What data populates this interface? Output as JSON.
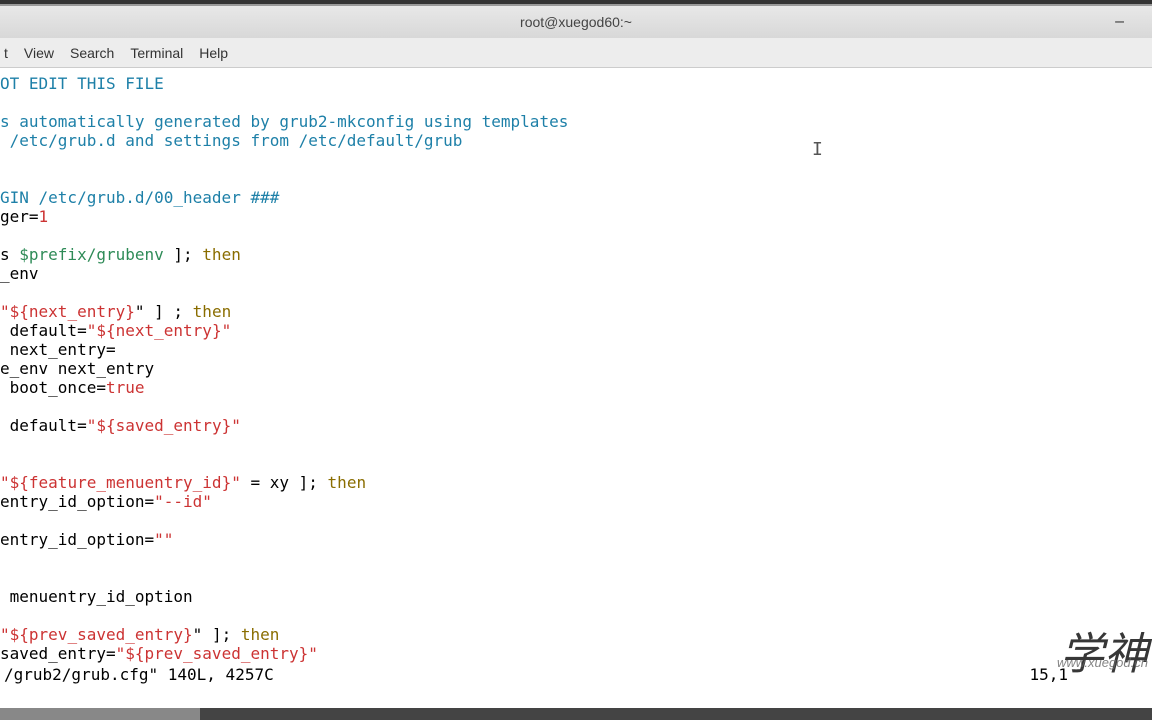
{
  "titlebar": {
    "title": "root@xuegod60:~"
  },
  "menubar": {
    "items": [
      "t",
      "View",
      "Search",
      "Terminal",
      "Help"
    ]
  },
  "code": {
    "l1": "OT EDIT THIS FILE",
    "l2": "",
    "l3": "s automatically generated by grub2-mkconfig using templates",
    "l4": " /etc/grub.d and settings from /etc/default/grub",
    "l5": "",
    "l6": "",
    "l7": "GIN /etc/grub.d/00_header ###",
    "l8a": "ger=",
    "l8b": "1",
    "l9": "",
    "l10a": "s ",
    "l10b": "$prefix/grubenv",
    "l10c": " ]; ",
    "l10d": "then",
    "l11": "_env",
    "l12": "",
    "l13a": "\"",
    "l13b": "${next_entry}",
    "l13c": "\" ] ",
    "l13d": "; ",
    "l13e": "then",
    "l14a": " default=",
    "l14b": "\"",
    "l14c": "${next_entry}",
    "l14d": "\"",
    "l15": " next_entry=",
    "l16": "e_env next_entry",
    "l17a": " boot_once=",
    "l17b": "true",
    "l18": "",
    "l19a": " default=",
    "l19b": "\"",
    "l19c": "${saved_entry}",
    "l19d": "\"",
    "l20": "",
    "l21": "",
    "l22a": "\"",
    "l22b": "${feature_menuentry_id}",
    "l22c": "\"",
    "l22d": " = xy ]; ",
    "l22e": "then",
    "l23a": "entry_id_option=",
    "l23b": "\"--id\"",
    "l24": "",
    "l25a": "entry_id_option=",
    "l25b": "\"\"",
    "l26": "",
    "l27": "",
    "l28": " menuentry_id_option",
    "l29": "",
    "l30a": "\"",
    "l30b": "${prev_saved_entry}",
    "l30c": "\" ]; ",
    "l30d": "then",
    "l31a": "saved_entry=",
    "l31b": "\"",
    "l31c": "${prev_saved_entry}",
    "l31d": "\""
  },
  "status": {
    "left": "/grub2/grub.cfg\" 140L, 4257C",
    "right": "15,1"
  },
  "watermark": {
    "main": "学神",
    "sub": "www.xuegod.cn"
  }
}
